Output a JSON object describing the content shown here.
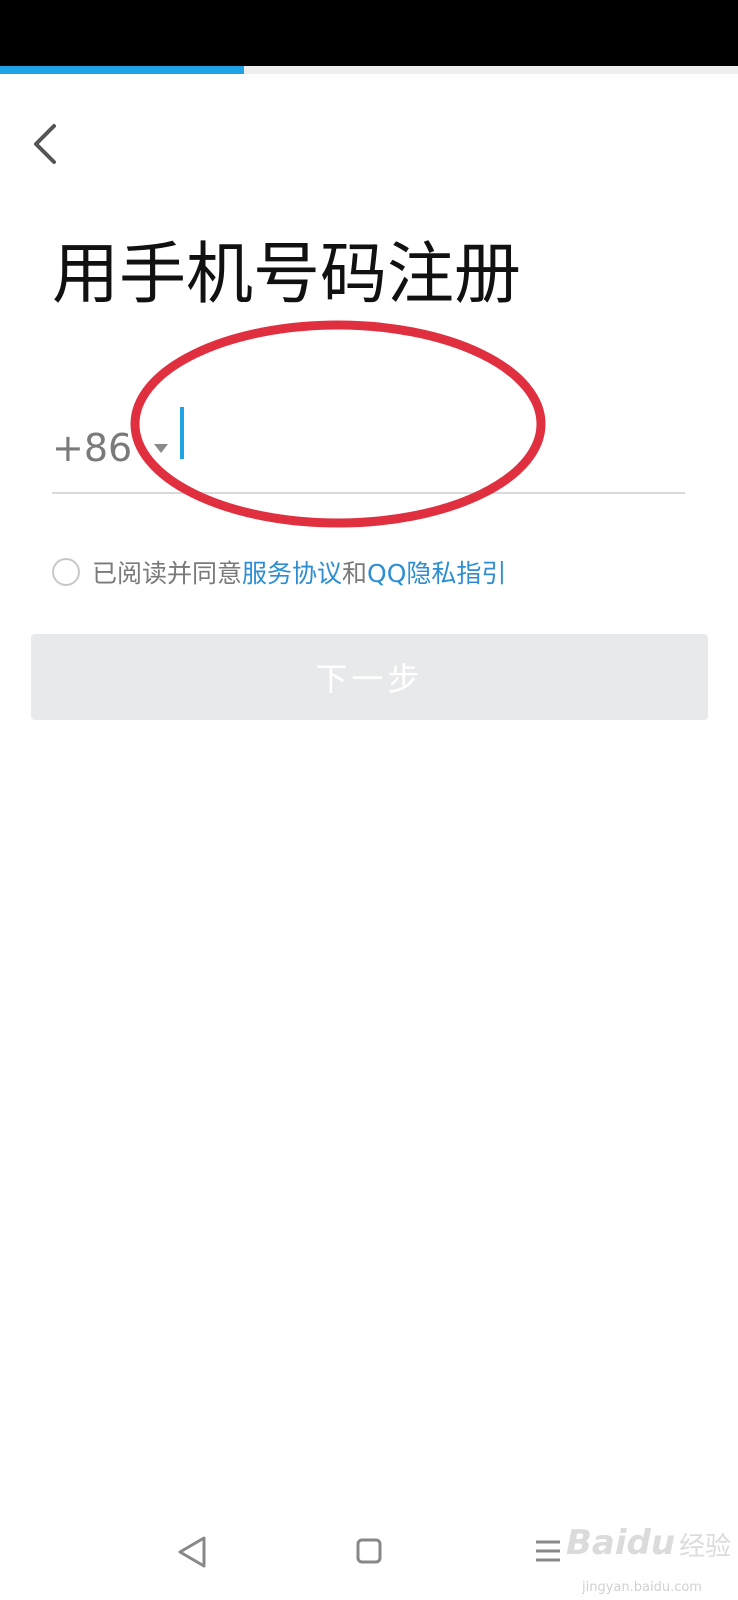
{
  "progress": {
    "fraction": 0.33,
    "color": "#1fa2e6"
  },
  "header": {
    "back_icon": "chevron-left-icon"
  },
  "main": {
    "title": "用手机号码注册",
    "country_code": "+86",
    "country_dropdown_icon": "caret-down-icon",
    "phone_value": "",
    "phone_placeholder": ""
  },
  "agreement": {
    "checked": false,
    "prefix": "已阅读并同意",
    "service_link": "服务协议",
    "conjunction": "和",
    "privacy_link": "QQ隐私指引",
    "link_color": "#2d8ed3"
  },
  "actions": {
    "next_label": "下一步",
    "next_enabled": false
  },
  "annotation": {
    "color": "#e0303f"
  },
  "nav_bar": {
    "back_icon": "triangle-back-icon",
    "home_icon": "square-home-icon",
    "menu_icon": "menu-icon"
  },
  "watermark": {
    "logo": "Baidu",
    "product": "经验",
    "url": "jingyan.baidu.com"
  }
}
